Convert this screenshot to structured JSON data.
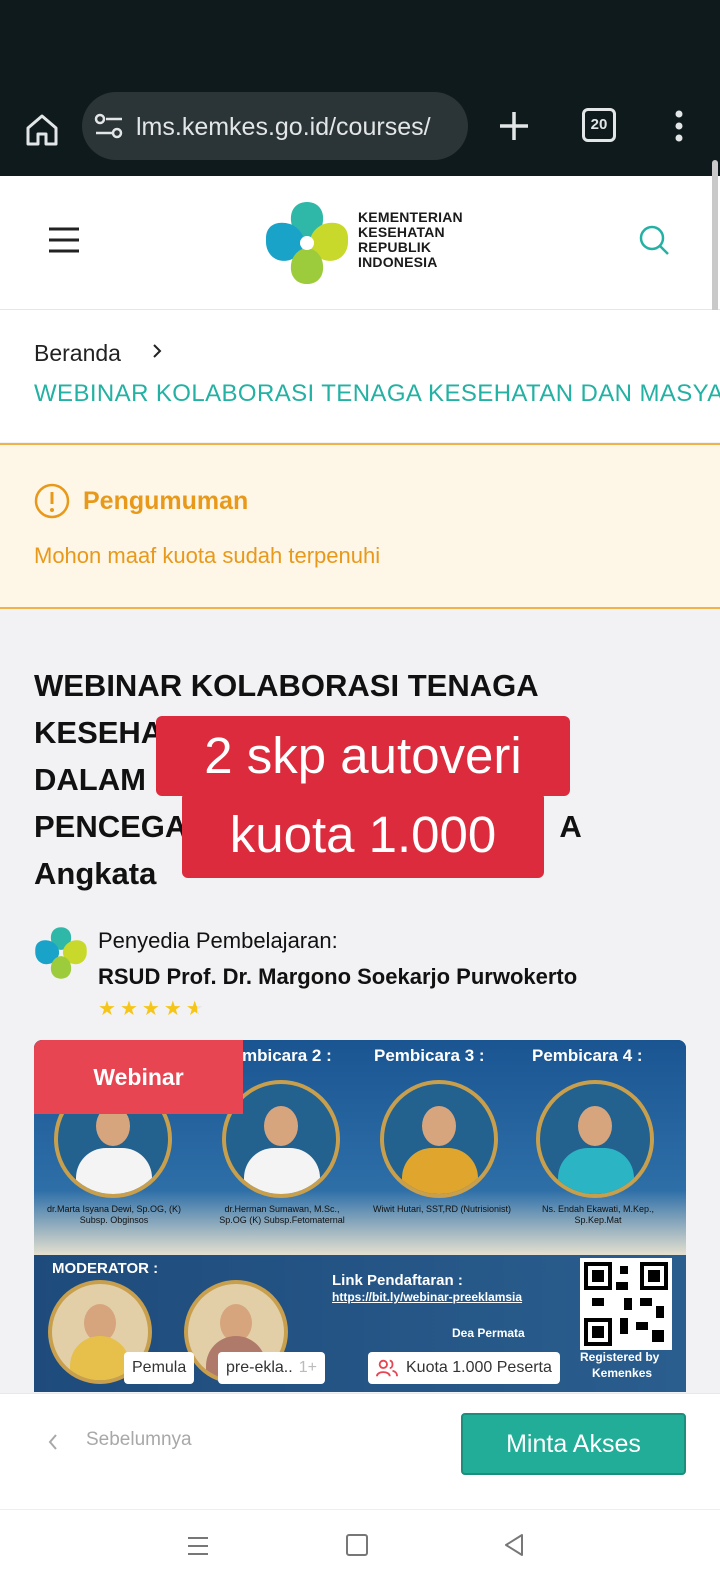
{
  "browser": {
    "url": "lms.kemkes.go.id/courses/",
    "tab_count": "20"
  },
  "header": {
    "logo_lines": [
      "KEMENTERIAN",
      "KESEHATAN",
      "REPUBLIK",
      "INDONESIA"
    ]
  },
  "breadcrumb": {
    "home": "Beranda",
    "current": "WEBINAR KOLABORASI TENAGA KESEHATAN DAN MASYARAKAT"
  },
  "announcement": {
    "title": "Pengumuman",
    "message": "Mohon maaf kuota sudah terpenuhi"
  },
  "course": {
    "title_lines": [
      "WEBINAR KOLABORASI TENAGA",
      "KESEHA",
      "DALAM",
      "PENCEGA",
      "Angkata"
    ],
    "title_tail": "A",
    "provider_label": "Penyedia Pembelajaran:",
    "provider_name": "RSUD Prof. Dr. Margono Soekarjo Purwokerto",
    "rating_stars": "★★★★★",
    "rating": 4.5
  },
  "overlay_caption": {
    "line1": "2 skp autoveri",
    "line2": "kuota 1.000"
  },
  "banner": {
    "badge": "Webinar",
    "speakers": [
      {
        "heading": "mbicara 2 :",
        "name": "dr.Herman Sumawan, M.Sc., Sp.OG (K) Subsp.Fetomaternal"
      },
      {
        "heading": "Pembicara 3 :",
        "name": "Wiwit Hutari, SST,RD (Nutrisionist)"
      },
      {
        "heading": "Pembicara 4 :",
        "name": "Ns. Endah Ekawati, M.Kep., Sp.Kep.Mat"
      }
    ],
    "speaker1_name": "dr.Marta Isyana Dewi, Sp.OG, (K) Subsp. Obginsos",
    "moderator_label": "MODERATOR :",
    "link_label": "Link Pendaftaran :",
    "link_url": "https://bit.ly/webinar-preeklamsia",
    "contact_name": "Dea Permata",
    "registered": "Registered by",
    "registered_org": "Kemenkes"
  },
  "chips": {
    "level": "Pemula",
    "tag": "pre-ekla..",
    "more": "1+",
    "quota": "Kuota 1.000 Peserta"
  },
  "footer": {
    "prev_label": "Sebelumnya",
    "request_access": "Minta Akses"
  },
  "colors": {
    "accent_teal": "#23b1a3",
    "warning_orange": "#e8991a",
    "caption_red": "#dc2b3c",
    "button_green": "#21ad97"
  }
}
